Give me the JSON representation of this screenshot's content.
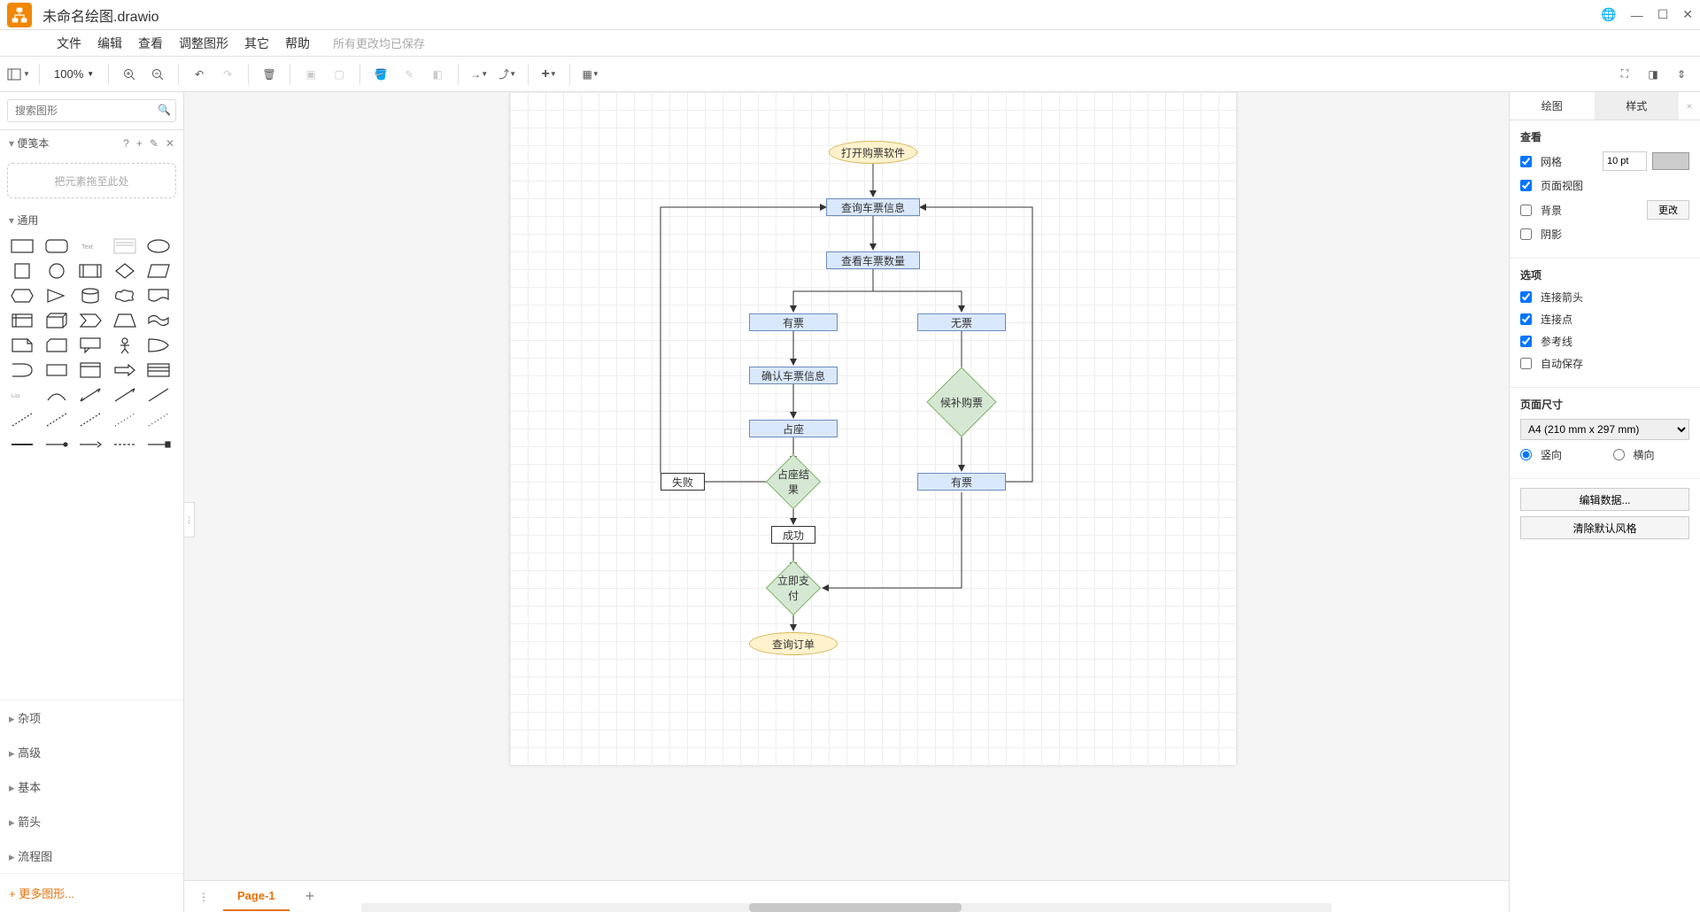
{
  "app": {
    "title": "未命名绘图.drawio",
    "save_status": "所有更改均已保存"
  },
  "menu": {
    "file": "文件",
    "edit": "编辑",
    "view": "查看",
    "arrange": "调整图形",
    "extras": "其它",
    "help": "帮助"
  },
  "toolbar": {
    "zoom": "100%"
  },
  "sidebar": {
    "search_placeholder": "搜索图形",
    "scratchpad_title": "便笺本",
    "scratchpad_hint": "把元素拖至此处",
    "shapes_section": "通用",
    "categories": [
      "杂项",
      "高级",
      "基本",
      "箭头",
      "流程图"
    ],
    "more_shapes": "+ 更多图形..."
  },
  "page_tabs": {
    "page1": "Page-1"
  },
  "flow": {
    "start": "打开购票软件",
    "query_info": "查询车票信息",
    "check_qty": "查看车票数量",
    "has_ticket": "有票",
    "no_ticket": "无票",
    "confirm_info": "确认车票信息",
    "reserve": "占座",
    "waitlist": "候补购票",
    "reserve_result": "占座结果",
    "fail": "失败",
    "has_ticket2": "有票",
    "success": "成功",
    "pay_now": "立即支付",
    "query_order": "查询订单"
  },
  "right_panel": {
    "tab_diagram": "绘图",
    "tab_style": "样式",
    "view_section": "查看",
    "grid": "网格",
    "grid_size": "10 pt",
    "page_view": "页面视图",
    "background": "背景",
    "change": "更改",
    "shadow": "阴影",
    "options_section": "选项",
    "conn_arrows": "连接箭头",
    "conn_points": "连接点",
    "guides": "参考线",
    "autosave": "自动保存",
    "page_size_section": "页面尺寸",
    "page_size": "A4 (210 mm x 297 mm)",
    "portrait": "竖向",
    "landscape": "横向",
    "edit_data": "编辑数据...",
    "clear_style": "清除默认风格"
  }
}
